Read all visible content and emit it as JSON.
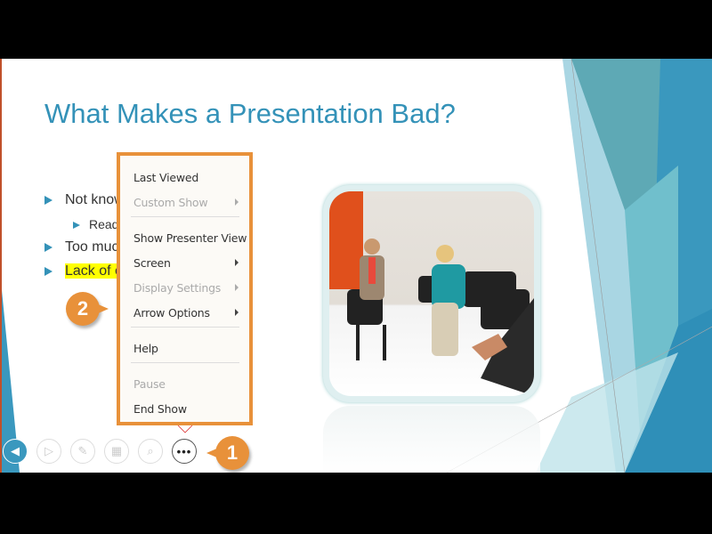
{
  "slide": {
    "title": "What Makes a Presentation Bad?",
    "bullets": [
      {
        "text": "Not know",
        "level": 1
      },
      {
        "text": "Read",
        "level": 2
      },
      {
        "text": "Too muc",
        "level": 1
      },
      {
        "text": "Lack of e",
        "level": 1,
        "highlighted": true
      }
    ],
    "accent_color": "#3492b8",
    "highlight_color": "#ffff00"
  },
  "context_menu": {
    "items": [
      {
        "label": "Last Viewed",
        "enabled": true,
        "submenu": false
      },
      {
        "label": "Custom Show",
        "enabled": false,
        "submenu": true
      },
      {
        "label": "Show Presenter View",
        "enabled": true,
        "submenu": false
      },
      {
        "label": "Screen",
        "enabled": true,
        "submenu": true
      },
      {
        "label": "Display Settings",
        "enabled": false,
        "submenu": true
      },
      {
        "label": "Arrow Options",
        "enabled": true,
        "submenu": true
      },
      {
        "label": "Help",
        "enabled": true,
        "submenu": false
      },
      {
        "label": "Pause",
        "enabled": false,
        "submenu": false
      },
      {
        "label": "End Show",
        "enabled": true,
        "submenu": false
      }
    ],
    "highlight_border_color": "#e8913a"
  },
  "toolbar": {
    "buttons": [
      {
        "icon": "previous-icon"
      },
      {
        "icon": "next-icon"
      },
      {
        "icon": "pen-icon"
      },
      {
        "icon": "see-all-slides-icon"
      },
      {
        "icon": "zoom-icon"
      },
      {
        "icon": "more-options-icon",
        "active": true
      }
    ]
  },
  "callouts": [
    {
      "label": "1"
    },
    {
      "label": "2"
    }
  ]
}
